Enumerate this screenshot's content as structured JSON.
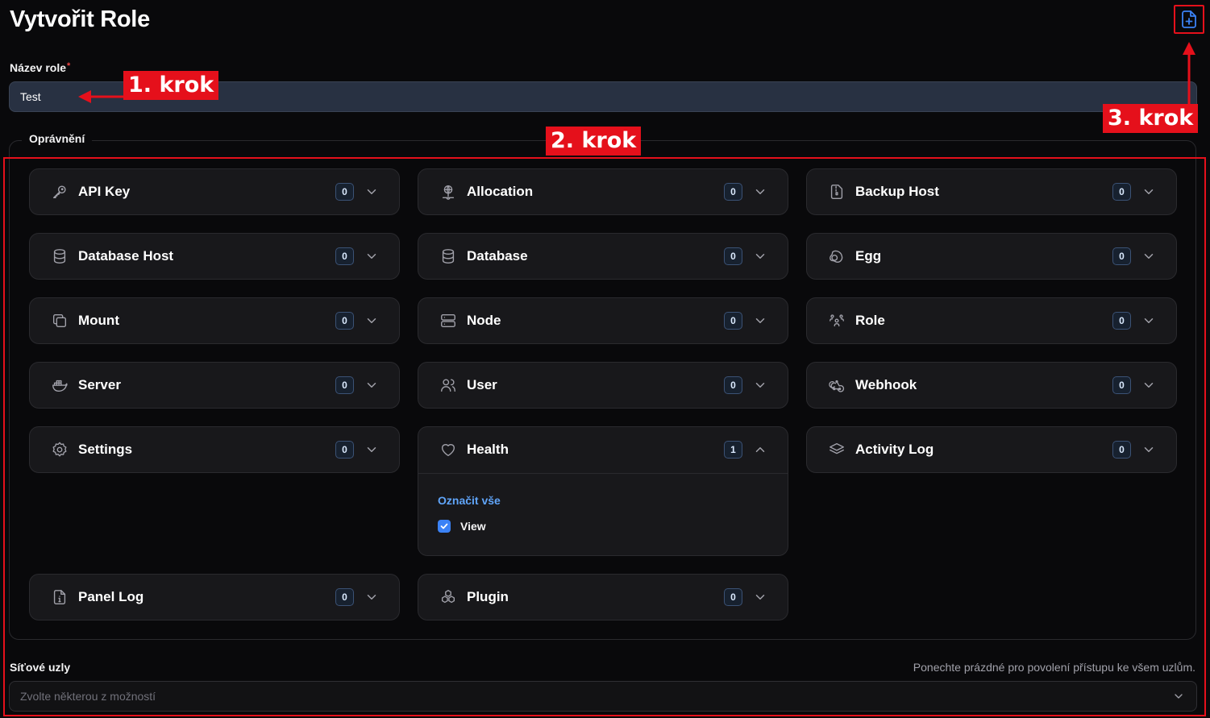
{
  "page": {
    "title": "Vytvořit Role"
  },
  "form": {
    "name_label": "Název role",
    "required_mark": "*",
    "name_value": "Test",
    "permissions_legend": "Oprávnění",
    "nodes_label": "Síťové uzly",
    "nodes_hint": "Ponechte prázdné pro povolení přístupu ke všem uzlům.",
    "nodes_placeholder": "Zvolte některou z možností"
  },
  "permissions": [
    {
      "label": "API Key",
      "count": "0",
      "icon": "key-icon",
      "expanded": false
    },
    {
      "label": "Allocation",
      "count": "0",
      "icon": "network-icon",
      "expanded": false
    },
    {
      "label": "Backup Host",
      "count": "0",
      "icon": "file-zip-icon",
      "expanded": false
    },
    {
      "label": "Database Host",
      "count": "0",
      "icon": "database-icon",
      "expanded": false
    },
    {
      "label": "Database",
      "count": "0",
      "icon": "database-icon",
      "expanded": false
    },
    {
      "label": "Egg",
      "count": "0",
      "icon": "egg-icon",
      "expanded": false
    },
    {
      "label": "Mount",
      "count": "0",
      "icon": "layers-copy-icon",
      "expanded": false
    },
    {
      "label": "Node",
      "count": "0",
      "icon": "server-stack-icon",
      "expanded": false
    },
    {
      "label": "Role",
      "count": "0",
      "icon": "users-group-icon",
      "expanded": false
    },
    {
      "label": "Server",
      "count": "0",
      "icon": "docker-icon",
      "expanded": false
    },
    {
      "label": "User",
      "count": "0",
      "icon": "users-icon",
      "expanded": false
    },
    {
      "label": "Webhook",
      "count": "0",
      "icon": "webhook-icon",
      "expanded": false
    },
    {
      "label": "Settings",
      "count": "0",
      "icon": "gear-icon",
      "expanded": false
    },
    {
      "label": "Health",
      "count": "1",
      "icon": "heart-icon",
      "expanded": true,
      "select_all": "Označit vše",
      "options": [
        {
          "label": "View",
          "checked": true
        }
      ]
    },
    {
      "label": "Activity Log",
      "count": "0",
      "icon": "stack-icon",
      "expanded": false
    },
    {
      "label": "Panel Log",
      "count": "0",
      "icon": "file-info-icon",
      "expanded": false
    },
    {
      "label": "Plugin",
      "count": "0",
      "icon": "cubes-icon",
      "expanded": false
    }
  ],
  "annotations": {
    "step1": "1. krok",
    "step2": "2. krok",
    "step3": "3. krok",
    "color": "#e5101b"
  },
  "colors": {
    "background": "#09090b",
    "card": "#18181b",
    "accent": "#3b82f6",
    "link": "#60a5fa"
  }
}
